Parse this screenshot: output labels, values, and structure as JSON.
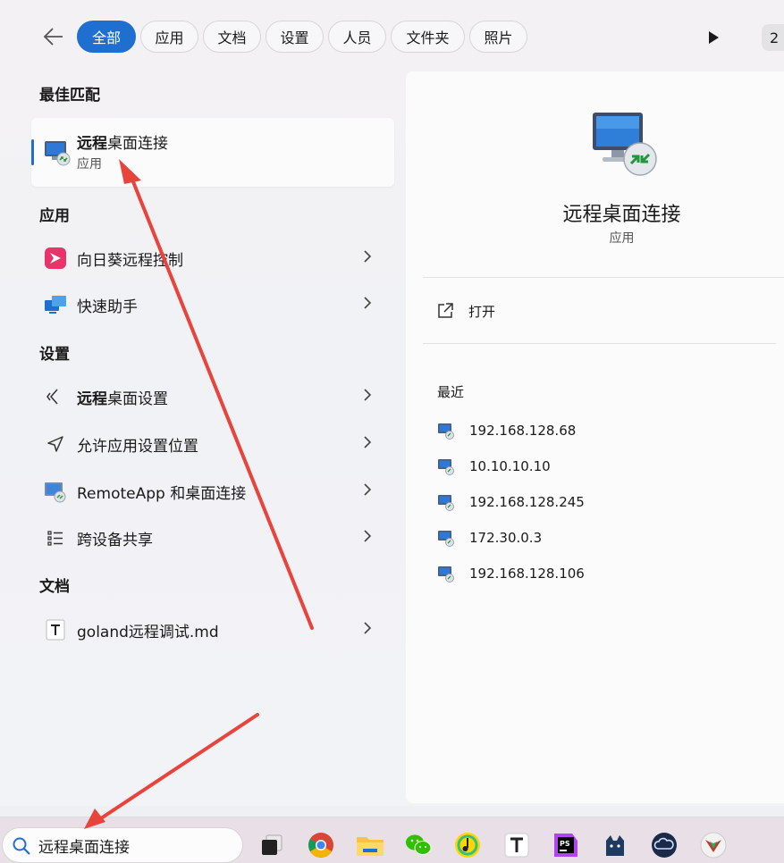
{
  "filters": {
    "tabs": [
      {
        "label": "全部",
        "active": true
      },
      {
        "label": "应用"
      },
      {
        "label": "文档"
      },
      {
        "label": "设置"
      },
      {
        "label": "人员"
      },
      {
        "label": "文件夹"
      },
      {
        "label": "照片"
      }
    ],
    "page_number": "2"
  },
  "best_match": {
    "section": "最佳匹配",
    "name_bold": "远程",
    "name_rest": "桌面连接",
    "type": "应用"
  },
  "apps": {
    "section": "应用",
    "items": [
      {
        "label": "向日葵远程控制"
      },
      {
        "label": "快速助手"
      }
    ]
  },
  "settings": {
    "section": "设置",
    "items": [
      {
        "bold": "远程",
        "rest": "桌面设置"
      },
      {
        "bold": "",
        "rest": "允许应用设置位置"
      },
      {
        "bold": "",
        "rest": "RemoteApp 和桌面连接"
      },
      {
        "bold": "",
        "rest": "跨设备共享"
      }
    ]
  },
  "docs": {
    "section": "文档",
    "items": [
      {
        "label": "goland远程调试.md"
      }
    ]
  },
  "detail": {
    "title": "远程桌面连接",
    "type": "应用",
    "open_label": "打开",
    "recent_title": "最近",
    "recent": [
      "192.168.128.68",
      "10.10.10.10",
      "192.168.128.245",
      "172.30.0.3",
      "192.168.128.106"
    ]
  },
  "taskbar": {
    "search_value": "远程桌面连接",
    "apps": [
      "task-view",
      "chrome",
      "file-explorer",
      "wechat",
      "qq-music",
      "typora",
      "phpstorm",
      "cat-app",
      "cloud-app",
      "game-app"
    ]
  },
  "colors": {
    "accent": "#1f6fd0",
    "annotation": "#e8443c"
  }
}
